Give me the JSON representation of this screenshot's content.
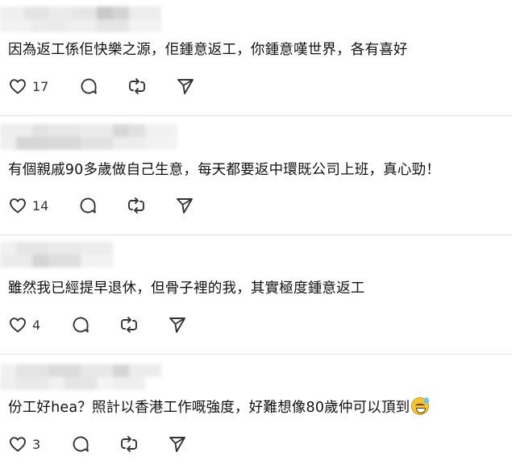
{
  "colors": {
    "text": "#111111",
    "icon": "#333333",
    "divider": "#e2e2e2",
    "blur_light": "#e6e6e6",
    "blur_mid": "#d2d2d2",
    "blur_dark": "#bdbdbd"
  },
  "comments": [
    {
      "text": "因為返工係佢快樂之源，佢鍾意返工，你鍾意嘆世界，各有喜好",
      "likes": "17",
      "has_emoji": false
    },
    {
      "text": "有個親戚90多歲做自己生意，每天都要返中環既公司上班，真心勁！",
      "likes": "14",
      "has_emoji": false
    },
    {
      "text": "雖然我已經提早退休，但骨子裡的我，其實極度鍾意返工",
      "likes": "4",
      "has_emoji": false
    },
    {
      "text": "份工好hea？照計以香港工作嘅強度，好難想像80歲仲可以頂到",
      "likes": "3",
      "has_emoji": true
    }
  ],
  "icons": {
    "like": "heart-icon",
    "reply": "speech-bubble-icon",
    "repost": "repost-arrows-icon",
    "share": "send-paper-plane-icon"
  }
}
